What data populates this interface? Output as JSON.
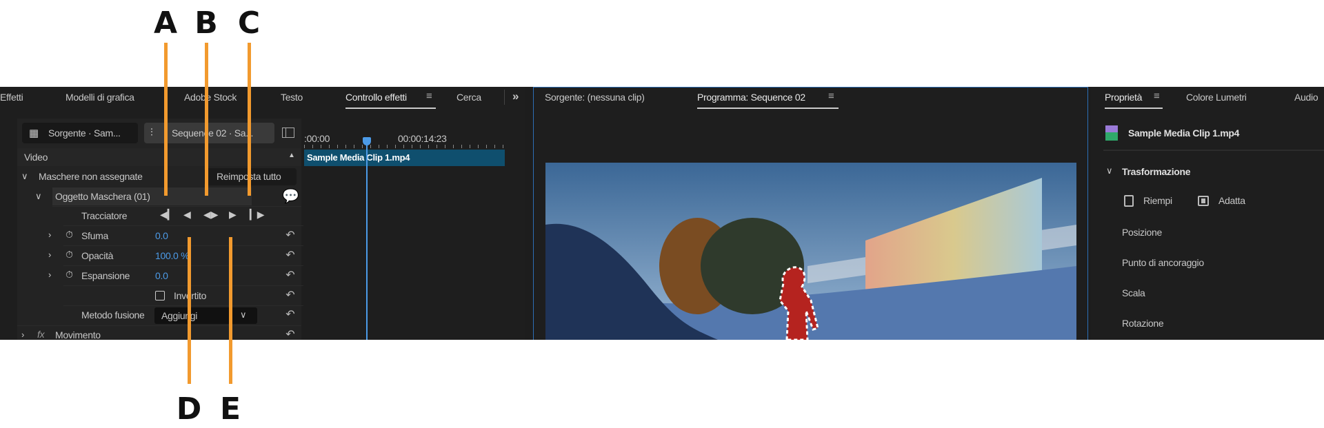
{
  "callouts": {
    "top": [
      "A",
      "B",
      "C"
    ],
    "bottom": [
      "D",
      "E"
    ]
  },
  "left_panel": {
    "tabs": [
      "Effetti",
      "Modelli di grafica",
      "Adobe Stock",
      "Testo",
      "Controllo effetti",
      "Cerca"
    ],
    "active_tab": "Controllo effetti",
    "overflow": "»",
    "source_button": "Sorgente · Sam...",
    "sequence_button": "Sequence 02 · Sa...",
    "section_video": "Video",
    "masks_group": "Maschere non assegnate",
    "reset_all": "Reimposta tutto",
    "mask_object": "Oggetto Maschera (01)",
    "tracker_label": "Tracciatore",
    "tracker_controls": [
      "track-backward-one",
      "track-backward",
      "track-both",
      "track-forward",
      "track-forward-one"
    ],
    "properties": [
      {
        "label": "Sfuma",
        "value": "0.0"
      },
      {
        "label": "Opacità",
        "value": "100.0 %"
      },
      {
        "label": "Espansione",
        "value": "0.0"
      }
    ],
    "inverted_label": "Invertito",
    "inverted_checked": false,
    "blend_label": "Metodo fusione",
    "blend_value": "Aggiungi",
    "motion_label": "Movimento",
    "fx_label": "fx"
  },
  "timeline": {
    "start": ":00:00",
    "time": "00:00:14:23",
    "clip": "Sample Media Clip 1.mp4"
  },
  "monitor": {
    "tabs": [
      "Sorgente: (nessuna clip)",
      "Programma: Sequence 02"
    ],
    "active_tab": "Programma: Sequence 02"
  },
  "right_panel": {
    "tabs": [
      "Proprietà",
      "Colore Lumetri",
      "Audio"
    ],
    "active_tab": "Proprietà",
    "clip_name": "Sample Media Clip 1.mp4",
    "section": "Trasformazione",
    "fill_label": "Riempi",
    "fit_label": "Adatta",
    "props": [
      "Posizione",
      "Punto di ancoraggio",
      "Scala",
      "Rotazione"
    ]
  },
  "colors": {
    "accent": "#4c9be8",
    "callout": "#f29a2e",
    "clip": "#0f4f6e",
    "mask": "#b5231f"
  }
}
